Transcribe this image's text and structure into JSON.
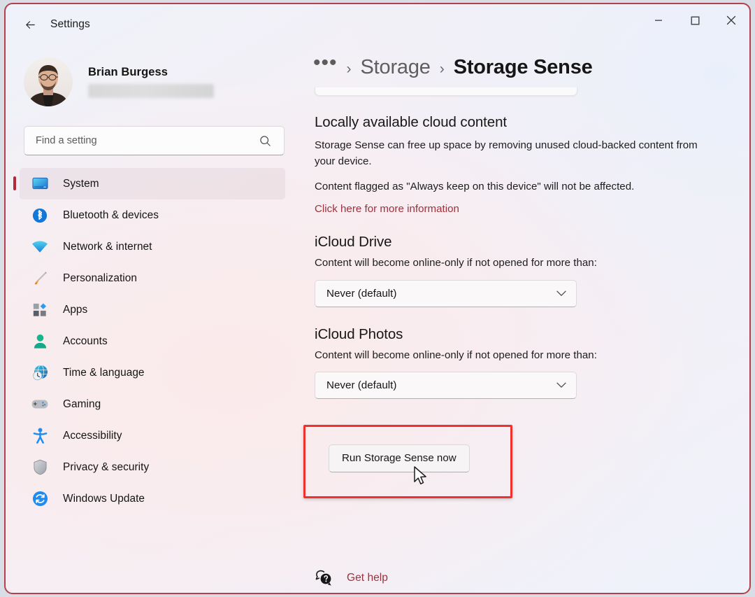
{
  "window": {
    "app_title": "Settings",
    "back_icon": "back-arrow-icon",
    "controls": {
      "minimize": "minimize-icon",
      "maximize": "maximize-icon",
      "close": "close-icon"
    },
    "accent_red": "#9e2f3c",
    "highlight_red": "#f0302e",
    "selection_bar": "#b5293a"
  },
  "sidebar": {
    "profile": {
      "name": "Brian Burgess",
      "email_redacted": true
    },
    "search": {
      "placeholder": "Find a setting",
      "value": "",
      "icon": "search-icon"
    },
    "items": [
      {
        "label": "System",
        "icon": "monitor-icon",
        "selected": true
      },
      {
        "label": "Bluetooth & devices",
        "icon": "bluetooth-icon",
        "selected": false
      },
      {
        "label": "Network & internet",
        "icon": "wifi-icon",
        "selected": false
      },
      {
        "label": "Personalization",
        "icon": "paintbrush-icon",
        "selected": false
      },
      {
        "label": "Apps",
        "icon": "apps-icon",
        "selected": false
      },
      {
        "label": "Accounts",
        "icon": "person-icon",
        "selected": false
      },
      {
        "label": "Time & language",
        "icon": "globe-clock-icon",
        "selected": false
      },
      {
        "label": "Gaming",
        "icon": "gamepad-icon",
        "selected": false
      },
      {
        "label": "Accessibility",
        "icon": "accessibility-icon",
        "selected": false
      },
      {
        "label": "Privacy & security",
        "icon": "shield-icon",
        "selected": false
      },
      {
        "label": "Windows Update",
        "icon": "update-icon",
        "selected": false
      }
    ]
  },
  "main": {
    "breadcrumb": {
      "overflow": "•••",
      "separator": "›",
      "parent": "Storage",
      "current": "Storage Sense"
    },
    "cloud_section": {
      "title": "Locally available cloud content",
      "paragraph_1": "Storage Sense can free up space by removing unused cloud-backed content from your device.",
      "paragraph_2": "Content flagged as \"Always keep on this device\" will not be affected.",
      "link": "Click here for more information"
    },
    "icloud_drive": {
      "title": "iCloud Drive",
      "description": "Content will become online-only if not opened for more than:",
      "selected_option": "Never (default)",
      "chevron": "chevron-down-icon"
    },
    "icloud_photos": {
      "title": "iCloud Photos",
      "description": "Content will become online-only if not opened for more than:",
      "selected_option": "Never (default)",
      "chevron": "chevron-down-icon"
    },
    "run_button": {
      "label": "Run Storage Sense now",
      "highlighted": true
    },
    "footer": {
      "icon": "get-help-icon",
      "label": "Get help"
    }
  }
}
